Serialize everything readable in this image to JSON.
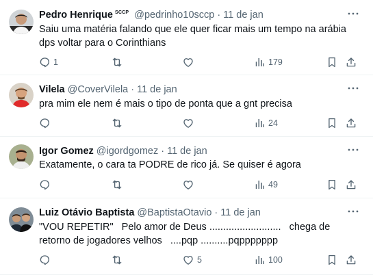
{
  "tweets": [
    {
      "name": "Pedro Henrique",
      "badge": "SCCP",
      "handle": "@pedrinho10sccp",
      "separator": "·",
      "time": "11 de jan",
      "text": "Saiu uma matéria falando que ele quer ficar mais um tempo na arábia dps voltar para o Corinthians",
      "replies": "1",
      "retweets": "",
      "likes": "",
      "views": "179"
    },
    {
      "name": "Vilela",
      "badge": "",
      "handle": "@CoverVilela",
      "separator": "·",
      "time": "11 de jan",
      "text": "pra mim ele nem é mais o tipo de ponta que a gnt precisa",
      "replies": "",
      "retweets": "",
      "likes": "",
      "views": "24"
    },
    {
      "name": "Igor Gomez",
      "badge": "",
      "handle": "@igordgomez",
      "separator": "·",
      "time": "11 de jan",
      "text": "Exatamente, o cara ta PODRE de rico já. Se quiser é agora",
      "replies": "",
      "retweets": "",
      "likes": "",
      "views": "49"
    },
    {
      "name": "Luiz Otávio Baptista",
      "badge": "",
      "handle": "@BaptistaOtavio",
      "separator": "·",
      "time": "11 de jan",
      "text": "\"VOU REPETIR\"   Pelo amor de Deus ..........................   chega de retorno de jogadores velhos   ....pqp ..........pqppppppp",
      "replies": "",
      "retweets": "",
      "likes": "5",
      "views": "100"
    }
  ],
  "icons": {
    "more": "more-horizontal-icon",
    "reply": "speech-bubble-icon",
    "retweet": "retweet-arrows-icon",
    "like": "heart-icon",
    "views": "bar-chart-icon",
    "bookmark": "bookmark-icon",
    "share": "share-upload-icon"
  },
  "colors": {
    "text": "#0f1419",
    "secondary": "#536471",
    "divider": "#eff3f4"
  }
}
